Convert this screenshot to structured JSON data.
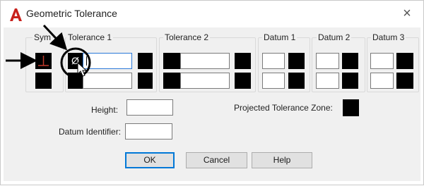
{
  "window": {
    "title": "Geometric Tolerance",
    "close_glyph": "×",
    "app_icon": "autocad-a-icon",
    "accent_color": "#c8211c"
  },
  "groups": {
    "sym": "Sym",
    "tolerance1": "Tolerance 1",
    "tolerance2": "Tolerance 2",
    "datum1": "Datum 1",
    "datum2": "Datum 2",
    "datum3": "Datum 3"
  },
  "symbols": {
    "diameter_glyph": "Ø"
  },
  "fields": {
    "height_label": "Height:",
    "projected_label": "Projected Tolerance Zone:",
    "datum_identifier_label": "Datum Identifier:"
  },
  "buttons": {
    "ok": "OK",
    "cancel": "Cancel",
    "help": "Help"
  },
  "colors": {
    "swatch": "#000000",
    "annotation": "#000000",
    "focus": "#2b79d8"
  }
}
